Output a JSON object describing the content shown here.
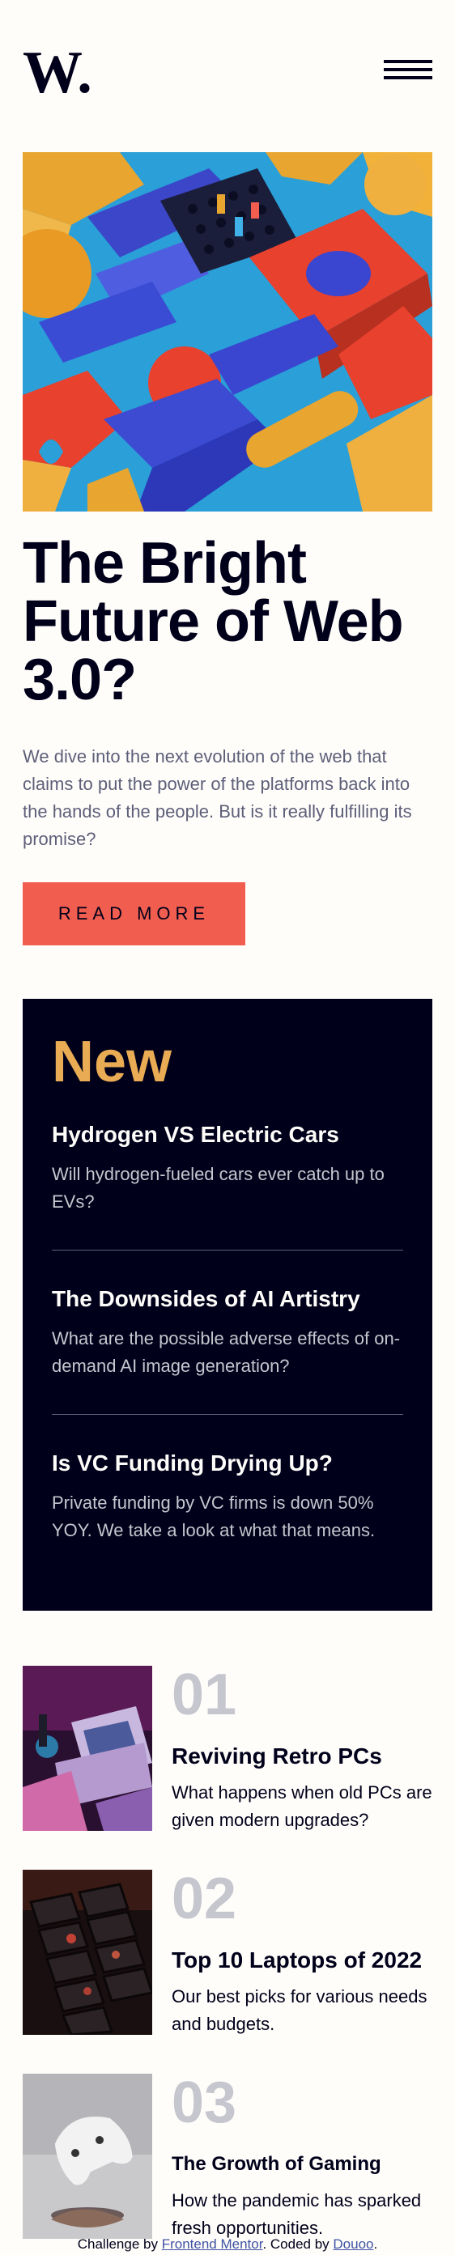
{
  "header": {
    "logo_text": "W.",
    "menu_icon": "hamburger-menu-icon"
  },
  "hero": {
    "image_description_icon": "abstract-3d-blocks-image",
    "title_line1": "The Bright",
    "title_line2": "Future of Web",
    "title_line3": "3.0?",
    "description": "We dive into the next evolution of the web that claims to put the power of the platforms back into the hands of the people. But is it really fulfilling its promise?",
    "cta_label": "Read more"
  },
  "new_section": {
    "heading": "New",
    "items": [
      {
        "title": "Hydrogen VS Electric Cars",
        "desc": "Will hydrogen-fueled cars ever catch up to EVs?"
      },
      {
        "title": "The Downsides of AI Artistry",
        "desc": "What are the possible adverse effects of on-demand AI image generation?"
      },
      {
        "title": "Is VC Funding Drying Up?",
        "desc": "Private funding by VC firms is down 50% YOY. We take a look at what that means."
      }
    ]
  },
  "trending": [
    {
      "number": "01",
      "title": "Reviving Retro PCs",
      "desc": "What happens when old PCs are given modern upgrades?"
    },
    {
      "number": "02",
      "title": "Top 10 Laptops of 2022",
      "desc": "Our best picks for various needs and budgets."
    },
    {
      "number": "03",
      "title": "The Growth of Gaming",
      "desc": "How the pandemic has sparked fresh opportunities."
    }
  ],
  "attribution": {
    "prefix": "Challenge by ",
    "link1": "Frontend Mentor",
    "middle": ". Coded by ",
    "link2": "Douoo",
    "suffix": "."
  },
  "colors": {
    "background": "#fffdfa",
    "dark": "#00001a",
    "accent_red": "#f15e50",
    "accent_orange": "#e9ab53",
    "grayish_blue": "#5d5f79",
    "light_gray": "#c5c6ce"
  }
}
